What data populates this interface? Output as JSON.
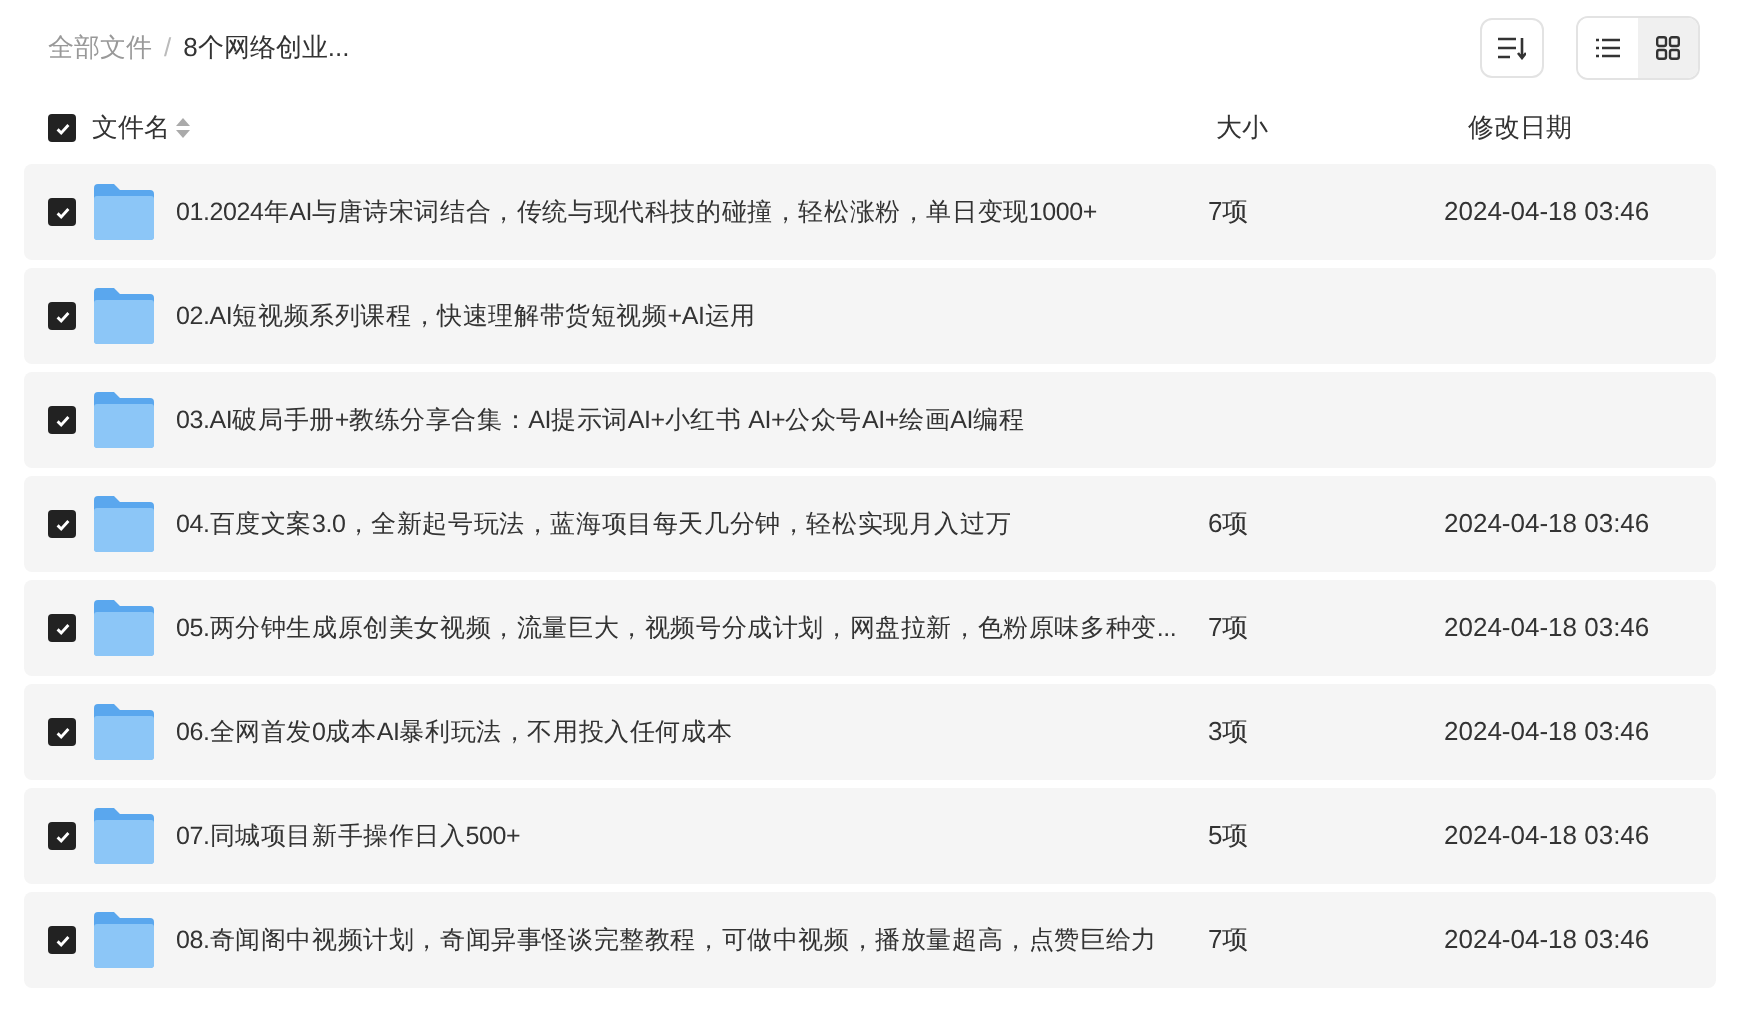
{
  "breadcrumb": [
    {
      "label": "全部文件",
      "current": false
    },
    {
      "label": "8个网络创业...",
      "current": true
    }
  ],
  "breadcrumb_separator": "/",
  "view_modes": [
    {
      "kind": "list",
      "selected": false
    },
    {
      "kind": "grid",
      "selected": true
    }
  ],
  "header": {
    "checked": true,
    "name": "文件名",
    "size": "大小",
    "date": "修改日期"
  },
  "rows": [
    {
      "checked": true,
      "name": "01.2024年AI与唐诗宋词结合，传统与现代科技的碰撞，轻松涨粉，单日变现1000+",
      "size": "7项",
      "date": "2024-04-18 03:46"
    },
    {
      "checked": true,
      "name": "02.AI短视频系列课程，快速理解带货短视频+AI运用"
    },
    {
      "checked": true,
      "name": "03.AI破局手册+教练分享合集：AI提示词AI+小红书 AI+公众号AI+绘画AI编程"
    },
    {
      "checked": true,
      "name": "04.百度文案3.0，全新起号玩法，蓝海项目每天几分钟，轻松实现月入过万",
      "size": "6项",
      "date": "2024-04-18 03:46"
    },
    {
      "checked": true,
      "name": "05.两分钟生成原创美女视频，流量巨大，视频号分成计划，网盘拉新，色粉原味多种变...",
      "size": "7项",
      "date": "2024-04-18 03:46"
    },
    {
      "checked": true,
      "name": "06.全网首发0成本AI暴利玩法，不用投入任何成本",
      "size": "3项",
      "date": "2024-04-18 03:46"
    },
    {
      "checked": true,
      "name": "07.同城项目新手操作日入500+",
      "size": "5项",
      "date": "2024-04-18 03:46"
    },
    {
      "checked": true,
      "name": "08.奇闻阁中视频计划，奇闻异事怪谈完整教程，可做中视频，播放量超高，点赞巨给力",
      "size": "7项",
      "date": "2024-04-18 03:46"
    }
  ]
}
